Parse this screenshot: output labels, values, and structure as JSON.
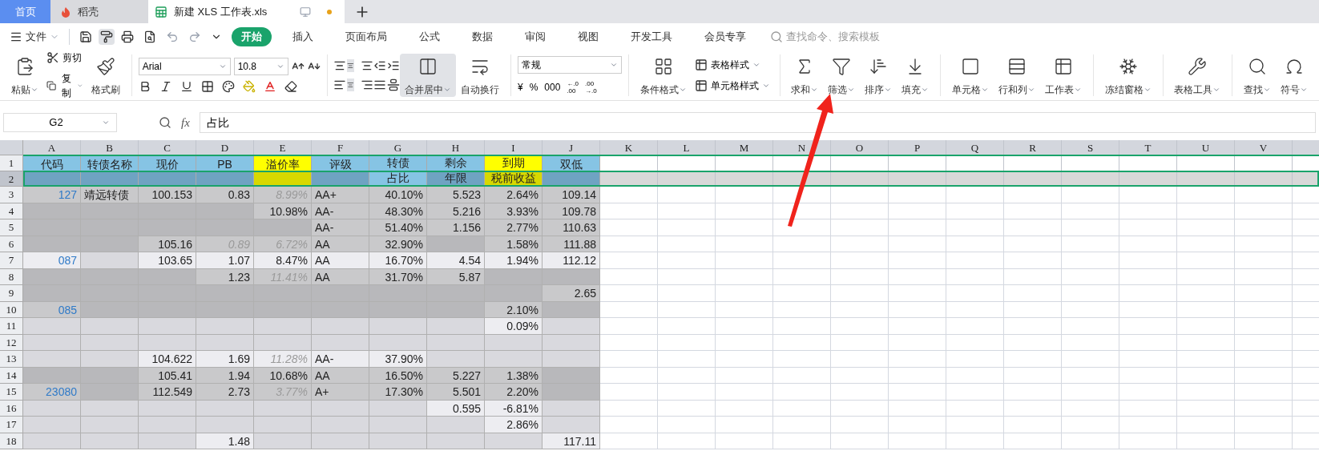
{
  "tabs": [
    {
      "label": "首页",
      "kind": "home",
      "selected": false
    },
    {
      "label": "稻壳",
      "kind": "app",
      "selected": false
    },
    {
      "label": "新建 XLS 工作表.xls",
      "kind": "doc",
      "selected": true
    }
  ],
  "menu": {
    "file": "文件",
    "items": [
      {
        "label": "开始",
        "selected": true
      },
      {
        "label": "插入",
        "selected": false
      },
      {
        "label": "页面布局",
        "selected": false
      },
      {
        "label": "公式",
        "selected": false
      },
      {
        "label": "数据",
        "selected": false
      },
      {
        "label": "审阅",
        "selected": false
      },
      {
        "label": "视图",
        "selected": false
      },
      {
        "label": "开发工具",
        "selected": false
      },
      {
        "label": "会员专享",
        "selected": false
      }
    ],
    "search": {
      "placeholder": "查找命令、搜索模板"
    }
  },
  "clipboard": {
    "paste": "粘贴",
    "cut": "剪切",
    "copy": "复制",
    "painter": "格式刷"
  },
  "font": {
    "name": "Arial",
    "size": "10.8"
  },
  "align": {
    "merge": "合并居中",
    "wrap": "自动换行"
  },
  "number": {
    "format": "常规",
    "symbols": [
      "¥",
      "%",
      "000"
    ],
    "decimals": [
      {
        "top": "←.0",
        "bottom": ".00"
      },
      {
        "top": ".00",
        "bottom": "→.0"
      }
    ]
  },
  "tools": [
    {
      "label": "条件格式",
      "kind": "cond"
    },
    {
      "label": "求和",
      "kind": "sum"
    },
    {
      "label": "筛选",
      "kind": "filter"
    },
    {
      "label": "排序",
      "kind": "sort"
    },
    {
      "label": "填充",
      "kind": "fill"
    },
    {
      "label": "单元格",
      "kind": "cell"
    },
    {
      "label": "行和列",
      "kind": "rowcol"
    },
    {
      "label": "工作表",
      "kind": "sheet"
    },
    {
      "label": "冻结窗格",
      "kind": "freeze"
    },
    {
      "label": "表格工具",
      "kind": "tabletool"
    },
    {
      "label": "查找",
      "kind": "find"
    },
    {
      "label": "符号",
      "kind": "symbol"
    }
  ],
  "styles": [
    "表格样式",
    "单元格样式"
  ],
  "name_box": "G2",
  "fx": "fx",
  "formula": "占比",
  "columns": [
    "A",
    "B",
    "C",
    "D",
    "E",
    "F",
    "G",
    "H",
    "I",
    "J",
    "K",
    "L",
    "M",
    "N",
    "O",
    "P",
    "Q",
    "R",
    "S",
    "T",
    "U",
    "V"
  ],
  "header_rows": [
    {
      "label": "1",
      "selected": false
    },
    {
      "label": "2",
      "selected": true
    }
  ],
  "header": [
    {
      "text": "代码",
      "color": "#86c4e4"
    },
    {
      "text": "转债名称",
      "color": "#86c4e4"
    },
    {
      "text": "现价",
      "color": "#86c4e4"
    },
    {
      "text": "PB",
      "color": "#86c4e4"
    },
    {
      "text": "溢价率",
      "color": "#ffff00"
    },
    {
      "text": "评级",
      "color": "#86c4e4"
    },
    {
      "top": "转债",
      "bottom": "占比",
      "color": "#86c4e4",
      "active": true
    },
    {
      "top": "剩余",
      "bottom": "年限",
      "color": "#86c4e4",
      "active": false
    },
    {
      "top": "到期",
      "bottom": "税前收益",
      "color": "#ffff00",
      "active": false
    },
    {
      "text": "双低",
      "color": "#86c4e4"
    }
  ],
  "rows": [
    {
      "label": "3",
      "light": false,
      "cells": [
        "127",
        "靖远转债",
        "100.153",
        "0.83",
        {
          "text": "8.99%",
          "muted": true
        },
        "AA+",
        "40.10%",
        "5.523",
        "2.64%",
        "109.14"
      ]
    },
    {
      "label": "4",
      "light": false,
      "cells": [
        null,
        null,
        null,
        null,
        "10.98%",
        "AA-",
        "48.30%",
        "5.216",
        "3.93%",
        "109.78"
      ]
    },
    {
      "label": "5",
      "light": false,
      "cells": [
        null,
        null,
        null,
        null,
        null,
        "AA-",
        "51.40%",
        "1.156",
        "2.77%",
        "110.63"
      ]
    },
    {
      "label": "6",
      "light": false,
      "cells": [
        null,
        null,
        "105.16",
        {
          "text": "0.89",
          "muted": true
        },
        {
          "text": "6.72%",
          "muted": true
        },
        "AA",
        "32.90%",
        null,
        "1.58%",
        "111.88"
      ]
    },
    {
      "label": "7",
      "light": true,
      "cells": [
        "087",
        null,
        "103.65",
        "1.07",
        "8.47%",
        "AA",
        "16.70%",
        "4.54",
        "1.94%",
        "112.12"
      ]
    },
    {
      "label": "8",
      "light": false,
      "cells": [
        null,
        null,
        null,
        "1.23",
        {
          "text": "11.41%",
          "muted": true
        },
        "AA",
        "31.70%",
        "5.87",
        null,
        null
      ]
    },
    {
      "label": "9",
      "light": false,
      "cells": [
        null,
        null,
        null,
        null,
        null,
        null,
        null,
        null,
        null,
        "2.65"
      ]
    },
    {
      "label": "10",
      "light": false,
      "cells": [
        "085",
        null,
        null,
        null,
        null,
        null,
        null,
        null,
        "2.10%",
        null
      ]
    },
    {
      "label": "11",
      "light": true,
      "cells": [
        null,
        null,
        null,
        null,
        null,
        null,
        null,
        null,
        "0.09%",
        null
      ]
    },
    {
      "label": "12",
      "light": true,
      "cells": [
        null,
        null,
        null,
        null,
        null,
        null,
        null,
        null,
        null,
        null
      ]
    },
    {
      "label": "13",
      "light": true,
      "cells": [
        null,
        null,
        "104.622",
        "1.69",
        {
          "text": "11.28%",
          "muted": true
        },
        "AA-",
        "37.90%",
        null,
        null,
        null
      ]
    },
    {
      "label": "14",
      "light": false,
      "cells": [
        null,
        null,
        "105.41",
        "1.94",
        "10.68%",
        "AA",
        "16.50%",
        "5.227",
        "1.38%",
        null
      ]
    },
    {
      "label": "15",
      "light": false,
      "cells": [
        "23080",
        null,
        "112.549",
        "2.73",
        {
          "text": "3.77%",
          "muted": true
        },
        "A+",
        "17.30%",
        "5.501",
        "2.20%",
        null
      ]
    },
    {
      "label": "16",
      "light": true,
      "cells": [
        null,
        null,
        null,
        null,
        null,
        null,
        null,
        "0.595",
        "-6.81%",
        null
      ]
    },
    {
      "label": "17",
      "light": true,
      "cells": [
        null,
        null,
        null,
        null,
        null,
        null,
        null,
        null,
        "2.86%",
        null
      ]
    },
    {
      "label": "18",
      "light": true,
      "cells": [
        null,
        null,
        null,
        "1.48",
        null,
        null,
        null,
        null,
        null,
        "117.11"
      ]
    }
  ]
}
